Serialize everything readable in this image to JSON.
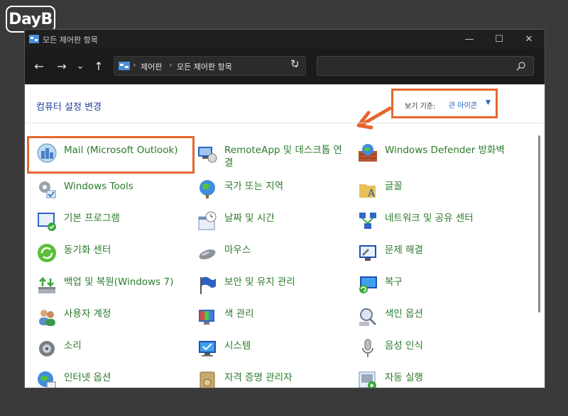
{
  "watermark": "DayB",
  "window": {
    "title": "모든 제어판 항목",
    "controls": [
      "—",
      "☐",
      "✕"
    ]
  },
  "address_bar": {
    "nav": [
      "←",
      "→",
      "⌄",
      "↑"
    ],
    "breadcrumbs": [
      "제어판",
      "모든 제어판 항목"
    ],
    "separator": "›",
    "refresh": "↻"
  },
  "header": {
    "heading": "컴퓨터 설정 변경",
    "view_by_label": "보기 기준:",
    "view_by_value": "큰 아이콘",
    "view_by_arrow": "▼"
  },
  "accent_color": "#e4672e",
  "link_color": "#2a7a2a",
  "items": [
    {
      "label": "Mail (Microsoft Outlook)",
      "icon": "mail-icon"
    },
    {
      "label": "RemoteApp 및 데스크톱 연결",
      "icon": "remoteapp-icon"
    },
    {
      "label": "Windows Defender 방화벽",
      "icon": "firewall-icon"
    },
    {
      "label": "Windows Tools",
      "icon": "windows-tools-icon"
    },
    {
      "label": "국가 또는 지역",
      "icon": "region-icon"
    },
    {
      "label": "글꼴",
      "icon": "fonts-icon"
    },
    {
      "label": "기본 프로그램",
      "icon": "default-programs-icon"
    },
    {
      "label": "날짜 및 시간",
      "icon": "date-time-icon"
    },
    {
      "label": "네트워크 및 공유 센터",
      "icon": "network-icon"
    },
    {
      "label": "동기화 센터",
      "icon": "sync-icon"
    },
    {
      "label": "마우스",
      "icon": "mouse-icon"
    },
    {
      "label": "문제 해결",
      "icon": "troubleshoot-icon"
    },
    {
      "label": "백업 및 복원(Windows 7)",
      "icon": "backup-icon"
    },
    {
      "label": "보안 및 유지 관리",
      "icon": "security-flag-icon"
    },
    {
      "label": "복구",
      "icon": "recovery-icon"
    },
    {
      "label": "사용자 계정",
      "icon": "user-accounts-icon"
    },
    {
      "label": "색 관리",
      "icon": "color-management-icon"
    },
    {
      "label": "색인 옵션",
      "icon": "indexing-icon"
    },
    {
      "label": "소리",
      "icon": "sound-icon"
    },
    {
      "label": "시스템",
      "icon": "system-icon"
    },
    {
      "label": "음성 인식",
      "icon": "speech-icon"
    },
    {
      "label": "인터넷 옵션",
      "icon": "internet-options-icon"
    },
    {
      "label": "자격 증명 관리자",
      "icon": "credential-manager-icon"
    },
    {
      "label": "자동 실행",
      "icon": "autoplay-icon"
    }
  ]
}
